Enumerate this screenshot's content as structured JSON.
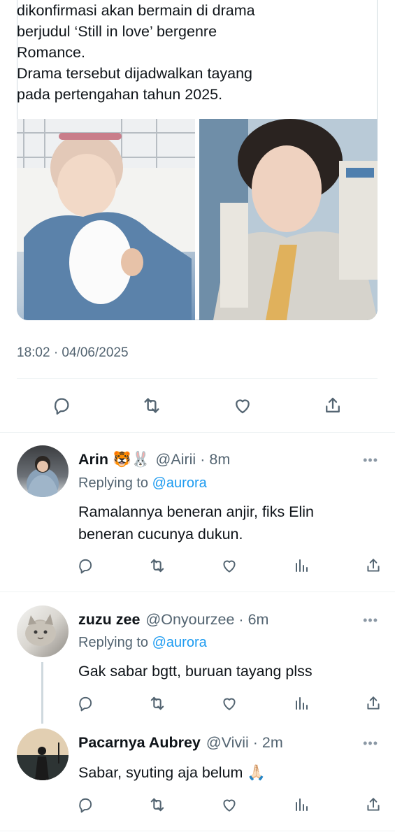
{
  "quoted_tweet": {
    "text_lines": [
      "dikonfirmasi akan bermain di drama",
      "berjudul ‘Still in love’ bergenre",
      "Romance.",
      "Drama tersebut dijadwalkan tayang",
      "pada pertengahan tahun 2025."
    ],
    "photos": [
      "photo-left",
      "photo-right"
    ]
  },
  "main_tweet": {
    "timestamp": "18:02 · 04/06/2025",
    "actions": [
      "reply-icon",
      "retweet-icon",
      "like-icon",
      "share-icon"
    ]
  },
  "replies": [
    {
      "name": "Arin",
      "emojis": "🐯🐰",
      "handle": "@Airii",
      "time": "8m",
      "replying_prefix": "Replying to ",
      "replying_to": "@aurora",
      "text_lines": [
        "Ramalannya beneran anjir, fiks Elin",
        "beneran cucunya dukun."
      ]
    },
    {
      "name": "zuzu zee",
      "emojis": "",
      "handle": "@Onyourzee",
      "time": "6m",
      "replying_prefix": "Replying to ",
      "replying_to": "@aurora",
      "text_lines": [
        "Gak sabar bgtt, buruan tayang plss"
      ]
    },
    {
      "name": "Pacarnya Aubrey",
      "emojis": "",
      "handle": "@Vivii",
      "time": "2m",
      "text_lines": [
        "Sabar, syuting aja belum 🙏🏻"
      ]
    }
  ],
  "more_label": "•••",
  "separator": "·",
  "colors": {
    "text": "#0f1419",
    "secondary": "#536471",
    "accent": "#1d9bf0",
    "divider": "#eff3f4"
  }
}
